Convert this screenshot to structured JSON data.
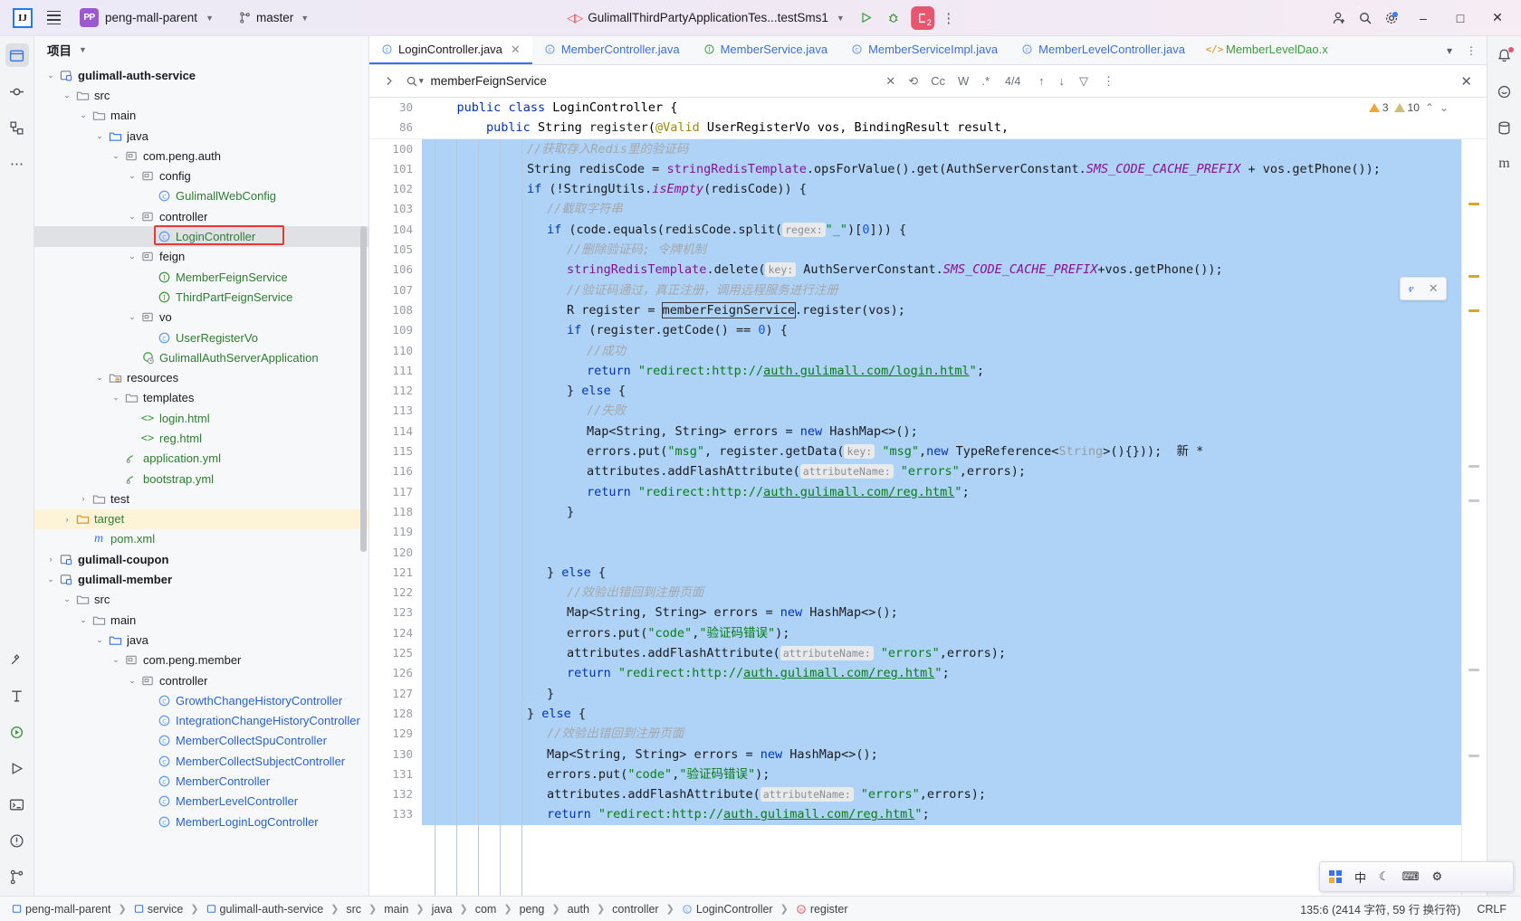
{
  "titlebar": {
    "logo_text": "IJ",
    "project_badge": "PP",
    "project_name": "peng-mall-parent",
    "branch_name": "master",
    "run_config": "GulimallThirdPartyApplicationTes...testSms1",
    "debug_badge_count": "2",
    "icons": {
      "menu": "hamburger-icon",
      "run": "run-icon",
      "debug": "debug-icon",
      "more": "more-vertical-icon",
      "account": "account-icon",
      "search": "search-icon",
      "settings": "settings-icon",
      "minimize": "–",
      "maximize": "□",
      "close": "✕"
    }
  },
  "project_panel": {
    "title": "项目",
    "tree": [
      {
        "indent": 2,
        "arrow": "down",
        "icon": "module",
        "label": "gulimall-auth-service",
        "style": "bold-dark"
      },
      {
        "indent": 3,
        "arrow": "down",
        "icon": "folder",
        "label": "src",
        "style": "dark"
      },
      {
        "indent": 4,
        "arrow": "down",
        "icon": "folder",
        "label": "main",
        "style": "dark"
      },
      {
        "indent": 5,
        "arrow": "down",
        "icon": "src-folder",
        "label": "java",
        "style": "dark"
      },
      {
        "indent": 6,
        "arrow": "down",
        "icon": "package",
        "label": "com.peng.auth",
        "style": "dark"
      },
      {
        "indent": 7,
        "arrow": "down",
        "icon": "package",
        "label": "config",
        "style": "dark"
      },
      {
        "indent": 8,
        "arrow": "none",
        "icon": "class",
        "label": "GulimallWebConfig",
        "style": "green"
      },
      {
        "indent": 7,
        "arrow": "down",
        "icon": "package",
        "label": "controller",
        "style": "dark"
      },
      {
        "indent": 8,
        "arrow": "none",
        "icon": "class",
        "label": "LoginController",
        "style": "green",
        "selected": true,
        "boxed": true
      },
      {
        "indent": 7,
        "arrow": "down",
        "icon": "package",
        "label": "feign",
        "style": "dark"
      },
      {
        "indent": 8,
        "arrow": "none",
        "icon": "interface",
        "label": "MemberFeignService",
        "style": "green"
      },
      {
        "indent": 8,
        "arrow": "none",
        "icon": "interface",
        "label": "ThirdPartFeignService",
        "style": "green"
      },
      {
        "indent": 7,
        "arrow": "down",
        "icon": "package",
        "label": "vo",
        "style": "dark"
      },
      {
        "indent": 8,
        "arrow": "none",
        "icon": "class",
        "label": "UserRegisterVo",
        "style": "green"
      },
      {
        "indent": 7,
        "arrow": "none",
        "icon": "spring",
        "label": "GulimallAuthServerApplication",
        "style": "green"
      },
      {
        "indent": 5,
        "arrow": "down",
        "icon": "res-folder",
        "label": "resources",
        "style": "dark"
      },
      {
        "indent": 6,
        "arrow": "down",
        "icon": "folder",
        "label": "templates",
        "style": "dark"
      },
      {
        "indent": 7,
        "arrow": "none",
        "icon": "html",
        "label": "login.html",
        "style": "green"
      },
      {
        "indent": 7,
        "arrow": "none",
        "icon": "html",
        "label": "reg.html",
        "style": "green"
      },
      {
        "indent": 6,
        "arrow": "none",
        "icon": "yml",
        "label": "application.yml",
        "style": "green"
      },
      {
        "indent": 6,
        "arrow": "none",
        "icon": "yml",
        "label": "bootstrap.yml",
        "style": "green"
      },
      {
        "indent": 4,
        "arrow": "right",
        "icon": "folder",
        "label": "test",
        "style": "dark"
      },
      {
        "indent": 3,
        "arrow": "right",
        "icon": "target-folder",
        "label": "target",
        "style": "orange",
        "target": true
      },
      {
        "indent": 4,
        "arrow": "none",
        "icon": "maven",
        "label": "pom.xml",
        "style": "green"
      },
      {
        "indent": 2,
        "arrow": "right",
        "icon": "module",
        "label": "gulimall-coupon",
        "style": "bold-dark"
      },
      {
        "indent": 2,
        "arrow": "down",
        "icon": "module",
        "label": "gulimall-member",
        "style": "bold-dark"
      },
      {
        "indent": 3,
        "arrow": "down",
        "icon": "folder",
        "label": "src",
        "style": "dark"
      },
      {
        "indent": 4,
        "arrow": "down",
        "icon": "folder",
        "label": "main",
        "style": "dark"
      },
      {
        "indent": 5,
        "arrow": "down",
        "icon": "src-folder",
        "label": "java",
        "style": "dark"
      },
      {
        "indent": 6,
        "arrow": "down",
        "icon": "package",
        "label": "com.peng.member",
        "style": "dark"
      },
      {
        "indent": 7,
        "arrow": "down",
        "icon": "package",
        "label": "controller",
        "style": "dark"
      },
      {
        "indent": 8,
        "arrow": "none",
        "icon": "class",
        "label": "GrowthChangeHistoryController",
        "style": "blue"
      },
      {
        "indent": 8,
        "arrow": "none",
        "icon": "class",
        "label": "IntegrationChangeHistoryController",
        "style": "blue"
      },
      {
        "indent": 8,
        "arrow": "none",
        "icon": "class",
        "label": "MemberCollectSpuController",
        "style": "blue"
      },
      {
        "indent": 8,
        "arrow": "none",
        "icon": "class",
        "label": "MemberCollectSubjectController",
        "style": "blue"
      },
      {
        "indent": 8,
        "arrow": "none",
        "icon": "class",
        "label": "MemberController",
        "style": "blue"
      },
      {
        "indent": 8,
        "arrow": "none",
        "icon": "class",
        "label": "MemberLevelController",
        "style": "blue"
      },
      {
        "indent": 8,
        "arrow": "none",
        "icon": "class",
        "label": "MemberLoginLogController",
        "style": "blue"
      }
    ]
  },
  "editor_tabs": [
    {
      "label": "LoginController.java",
      "icon": "class",
      "active": true,
      "closable": true
    },
    {
      "label": "MemberController.java",
      "icon": "class",
      "active": false
    },
    {
      "label": "MemberService.java",
      "icon": "interface",
      "active": false
    },
    {
      "label": "MemberServiceImpl.java",
      "icon": "class",
      "active": false
    },
    {
      "label": "MemberLevelController.java",
      "icon": "class",
      "active": false
    },
    {
      "label": "MemberLevelDao.x",
      "icon": "xml",
      "active": false
    }
  ],
  "find_bar": {
    "query": "memberFeignService",
    "placeholder": "",
    "match_count": "4/4",
    "case_label": "Cc",
    "words_label": "W",
    "regex_label": ".*",
    "icons": {
      "expand": "chevron-right-icon",
      "search": "search-dropdown-icon",
      "clear": "clear-icon",
      "history": "history-icon",
      "prev": "arrow-up-icon",
      "next": "arrow-down-icon",
      "filter": "filter-icon",
      "more": "more-vertical-icon",
      "close": "close-icon"
    }
  },
  "inspections": {
    "warnings": "3",
    "weak_warnings": "10"
  },
  "breadcrumb_top": [
    {
      "num": "30",
      "text": "public class LoginController {"
    },
    {
      "num": "86",
      "text": "public String register(@Valid UserRegisterVo vos, BindingResult result,"
    }
  ],
  "code_lines": [
    {
      "num": "100",
      "indent": 5,
      "tokens": [
        {
          "t": "cmt",
          "v": "//获取存入Redis里的验证码"
        }
      ]
    },
    {
      "num": "101",
      "indent": 5,
      "tokens": [
        {
          "t": "p",
          "v": "String redisCode = "
        },
        {
          "t": "fld",
          "v": "stringRedisTemplate"
        },
        {
          "t": "p",
          "v": ".opsForValue().get(AuthServerConstant."
        },
        {
          "t": "cnst",
          "v": "SMS_CODE_CACHE_PREFIX"
        },
        {
          "t": "p",
          "v": " + vos.getPhone());"
        }
      ]
    },
    {
      "num": "102",
      "indent": 5,
      "tokens": [
        {
          "t": "kw",
          "v": "if"
        },
        {
          "t": "p",
          "v": " (!StringUtils."
        },
        {
          "t": "sfld",
          "v": "isEmpty"
        },
        {
          "t": "p",
          "v": "(redisCode)) {"
        }
      ]
    },
    {
      "num": "103",
      "indent": 6,
      "tokens": [
        {
          "t": "cmt",
          "v": "//截取字符串"
        }
      ]
    },
    {
      "num": "104",
      "indent": 6,
      "tokens": [
        {
          "t": "kw",
          "v": "if"
        },
        {
          "t": "p",
          "v": " (code.equals(redisCode.split("
        },
        {
          "t": "hint",
          "v": "regex:"
        },
        {
          "t": "str",
          "v": "\"_\""
        },
        {
          "t": "p",
          "v": ")["
        },
        {
          "t": "num",
          "v": "0"
        },
        {
          "t": "p",
          "v": "])) {"
        }
      ]
    },
    {
      "num": "105",
      "indent": 7,
      "tokens": [
        {
          "t": "cmt",
          "v": "//删除验证码; 令牌机制"
        }
      ]
    },
    {
      "num": "106",
      "indent": 7,
      "tokens": [
        {
          "t": "fld",
          "v": "stringRedisTemplate"
        },
        {
          "t": "p",
          "v": ".delete("
        },
        {
          "t": "hint",
          "v": "key:"
        },
        {
          "t": "p",
          "v": " AuthServerConstant."
        },
        {
          "t": "cnst",
          "v": "SMS_CODE_CACHE_PREFIX"
        },
        {
          "t": "p",
          "v": "+vos.getPhone());"
        }
      ]
    },
    {
      "num": "107",
      "indent": 7,
      "tokens": [
        {
          "t": "cmt",
          "v": "//验证码通过，真正注册，调用远程服务进行注册"
        }
      ]
    },
    {
      "num": "108",
      "indent": 7,
      "tokens": [
        {
          "t": "p",
          "v": "R register = "
        },
        {
          "t": "box",
          "v": "memberFeignService"
        },
        {
          "t": "p",
          "v": ".register(vos);"
        }
      ]
    },
    {
      "num": "109",
      "indent": 7,
      "tokens": [
        {
          "t": "kw",
          "v": "if"
        },
        {
          "t": "p",
          "v": " (register.getCode() == "
        },
        {
          "t": "num",
          "v": "0"
        },
        {
          "t": "p",
          "v": ") {"
        }
      ]
    },
    {
      "num": "110",
      "indent": 8,
      "tokens": [
        {
          "t": "cmt",
          "v": "//成功"
        }
      ]
    },
    {
      "num": "111",
      "indent": 8,
      "tokens": [
        {
          "t": "kw",
          "v": "return"
        },
        {
          "t": "p",
          "v": " "
        },
        {
          "t": "str",
          "v": "\"redirect:http://"
        },
        {
          "t": "url",
          "v": "auth.gulimall.com/login.html"
        },
        {
          "t": "str",
          "v": "\""
        },
        {
          "t": "p",
          "v": ";"
        }
      ]
    },
    {
      "num": "112",
      "indent": 7,
      "tokens": [
        {
          "t": "p",
          "v": "} "
        },
        {
          "t": "kw",
          "v": "else"
        },
        {
          "t": "p",
          "v": " {"
        }
      ]
    },
    {
      "num": "113",
      "indent": 8,
      "tokens": [
        {
          "t": "cmt",
          "v": "//失败"
        }
      ]
    },
    {
      "num": "114",
      "indent": 8,
      "tokens": [
        {
          "t": "p",
          "v": "Map<String, String> errors = "
        },
        {
          "t": "kw",
          "v": "new"
        },
        {
          "t": "p",
          "v": " HashMap<>();"
        }
      ]
    },
    {
      "num": "115",
      "indent": 8,
      "tokens": [
        {
          "t": "p",
          "v": "errors.put("
        },
        {
          "t": "str",
          "v": "\"msg\""
        },
        {
          "t": "p",
          "v": ", register.getData("
        },
        {
          "t": "hint",
          "v": "key:"
        },
        {
          "t": "str",
          "v": " \"msg\""
        },
        {
          "t": "p",
          "v": ","
        },
        {
          "t": "kw",
          "v": "new"
        },
        {
          "t": "p",
          "v": " TypeReference<"
        },
        {
          "t": "gray",
          "v": "String"
        },
        {
          "t": "p",
          "v": ">(){}));  新 *"
        }
      ]
    },
    {
      "num": "116",
      "indent": 8,
      "tokens": [
        {
          "t": "p",
          "v": "attributes.addFlashAttribute("
        },
        {
          "t": "hint",
          "v": "attributeName:"
        },
        {
          "t": "str",
          "v": " \"errors\""
        },
        {
          "t": "p",
          "v": ",errors);"
        }
      ]
    },
    {
      "num": "117",
      "indent": 8,
      "tokens": [
        {
          "t": "kw",
          "v": "return"
        },
        {
          "t": "p",
          "v": " "
        },
        {
          "t": "str",
          "v": "\"redirect:http://"
        },
        {
          "t": "url",
          "v": "auth.gulimall.com/reg.html"
        },
        {
          "t": "str",
          "v": "\""
        },
        {
          "t": "p",
          "v": ";"
        }
      ]
    },
    {
      "num": "118",
      "indent": 7,
      "tokens": [
        {
          "t": "p",
          "v": "}"
        }
      ]
    },
    {
      "num": "119",
      "indent": 0,
      "tokens": []
    },
    {
      "num": "120",
      "indent": 0,
      "tokens": []
    },
    {
      "num": "121",
      "indent": 6,
      "tokens": [
        {
          "t": "p",
          "v": "} "
        },
        {
          "t": "kw",
          "v": "else"
        },
        {
          "t": "p",
          "v": " {"
        }
      ]
    },
    {
      "num": "122",
      "indent": 7,
      "tokens": [
        {
          "t": "cmt",
          "v": "//效验出错回到注册页面"
        }
      ]
    },
    {
      "num": "123",
      "indent": 7,
      "tokens": [
        {
          "t": "p",
          "v": "Map<String, String> errors = "
        },
        {
          "t": "kw",
          "v": "new"
        },
        {
          "t": "p",
          "v": " HashMap<>();"
        }
      ]
    },
    {
      "num": "124",
      "indent": 7,
      "tokens": [
        {
          "t": "p",
          "v": "errors.put("
        },
        {
          "t": "str",
          "v": "\"code\""
        },
        {
          "t": "p",
          "v": ","
        },
        {
          "t": "str",
          "v": "\"验证码错误\""
        },
        {
          "t": "p",
          "v": ");"
        }
      ]
    },
    {
      "num": "125",
      "indent": 7,
      "tokens": [
        {
          "t": "p",
          "v": "attributes.addFlashAttribute("
        },
        {
          "t": "hint",
          "v": "attributeName:"
        },
        {
          "t": "str",
          "v": " \"errors\""
        },
        {
          "t": "p",
          "v": ",errors);"
        }
      ]
    },
    {
      "num": "126",
      "indent": 7,
      "tokens": [
        {
          "t": "kw",
          "v": "return"
        },
        {
          "t": "p",
          "v": " "
        },
        {
          "t": "str",
          "v": "\"redirect:http://"
        },
        {
          "t": "url",
          "v": "auth.gulimall.com/reg.html"
        },
        {
          "t": "str",
          "v": "\""
        },
        {
          "t": "p",
          "v": ";"
        }
      ]
    },
    {
      "num": "127",
      "indent": 6,
      "tokens": [
        {
          "t": "p",
          "v": "}"
        }
      ]
    },
    {
      "num": "128",
      "indent": 5,
      "tokens": [
        {
          "t": "p",
          "v": "} "
        },
        {
          "t": "kw",
          "v": "else"
        },
        {
          "t": "p",
          "v": " {"
        }
      ]
    },
    {
      "num": "129",
      "indent": 6,
      "tokens": [
        {
          "t": "cmt",
          "v": "//效验出错回到注册页面"
        }
      ]
    },
    {
      "num": "130",
      "indent": 6,
      "tokens": [
        {
          "t": "p",
          "v": "Map<String, String> errors = "
        },
        {
          "t": "kw",
          "v": "new"
        },
        {
          "t": "p",
          "v": " HashMap<>();"
        }
      ]
    },
    {
      "num": "131",
      "indent": 6,
      "tokens": [
        {
          "t": "p",
          "v": "errors.put("
        },
        {
          "t": "str",
          "v": "\"code\""
        },
        {
          "t": "p",
          "v": ","
        },
        {
          "t": "str",
          "v": "\"验证码错误\""
        },
        {
          "t": "p",
          "v": ");"
        }
      ]
    },
    {
      "num": "132",
      "indent": 6,
      "tokens": [
        {
          "t": "p",
          "v": "attributes.addFlashAttribute("
        },
        {
          "t": "hint",
          "v": "attributeName:"
        },
        {
          "t": "str",
          "v": " \"errors\""
        },
        {
          "t": "p",
          "v": ",errors);"
        }
      ]
    },
    {
      "num": "133",
      "indent": 6,
      "tokens": [
        {
          "t": "kw",
          "v": "return"
        },
        {
          "t": "p",
          "v": " "
        },
        {
          "t": "str",
          "v": "\"redirect:http://"
        },
        {
          "t": "url",
          "v": "auth.gulimall.com/reg.html"
        },
        {
          "t": "str",
          "v": "\""
        },
        {
          "t": "p",
          "v": ";"
        }
      ]
    }
  ],
  "status_bar": {
    "breadcrumbs": [
      {
        "label": "peng-mall-parent",
        "icon": "module"
      },
      {
        "label": "service",
        "icon": "module"
      },
      {
        "label": "gulimall-auth-service",
        "icon": "module"
      },
      {
        "label": "src",
        "icon": "none"
      },
      {
        "label": "main",
        "icon": "none"
      },
      {
        "label": "java",
        "icon": "none"
      },
      {
        "label": "com",
        "icon": "none"
      },
      {
        "label": "peng",
        "icon": "none"
      },
      {
        "label": "auth",
        "icon": "none"
      },
      {
        "label": "controller",
        "icon": "none"
      },
      {
        "label": "LoginController",
        "icon": "class"
      },
      {
        "label": "register",
        "icon": "method"
      }
    ],
    "caret_position": "135:6 (2414 字符, 59 行 换行符)",
    "line_separator": "CRLF"
  },
  "ime_bar": {
    "lang": "中",
    "items": [
      "keyboard-icon",
      "chinese-mode",
      "moon-icon",
      "keyboard2-icon",
      "settings-icon"
    ]
  },
  "colors": {
    "accent": "#3574f0",
    "selection": "#aed3f6",
    "string": "#067d17",
    "keyword": "#0033b3",
    "comment": "#a5a7ab",
    "field": "#871094",
    "warning": "#f0a732",
    "error": "#e53935"
  }
}
